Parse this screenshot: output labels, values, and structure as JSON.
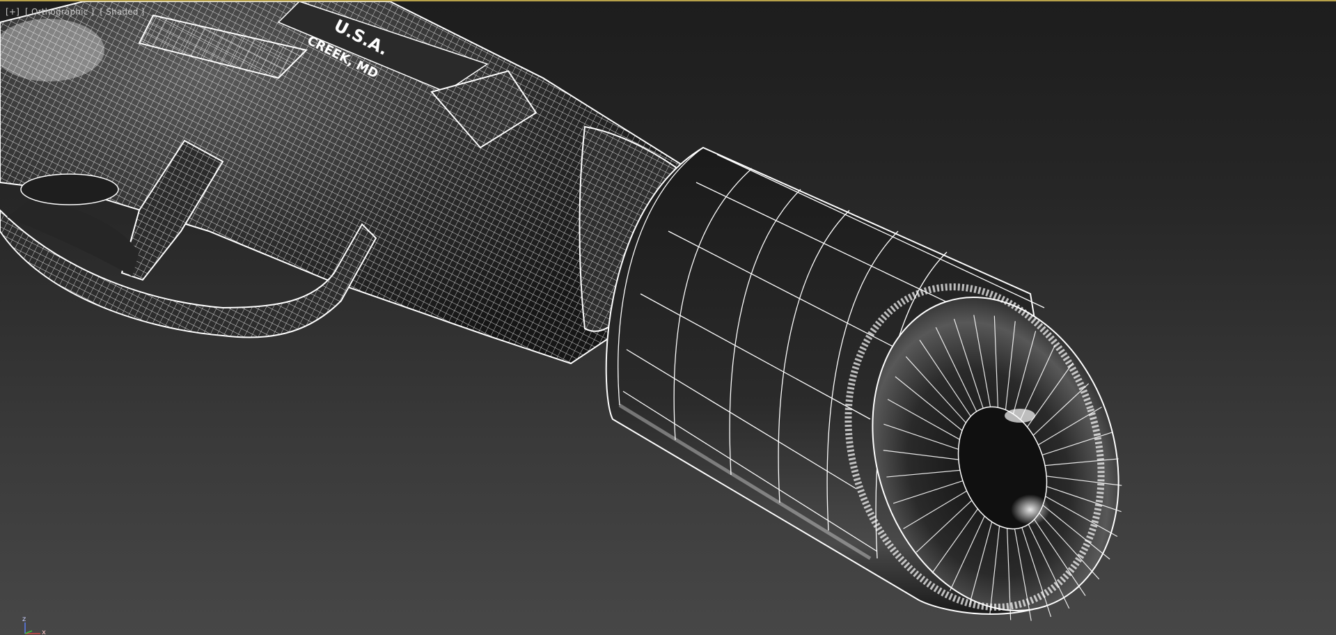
{
  "viewport": {
    "label": {
      "menu": "[+]",
      "view": "[ Orthographic ]",
      "shading": "[ Shaded ]"
    },
    "model_text": {
      "line1": "U.S.A.",
      "line2": "CREEK, MD"
    },
    "axis_gizmo": {
      "z": "z",
      "x": "x",
      "y_color": "#3cc43c",
      "x_color": "#d24a4a",
      "z_color": "#5a7cf0"
    },
    "border_color": "#b8a24a"
  }
}
